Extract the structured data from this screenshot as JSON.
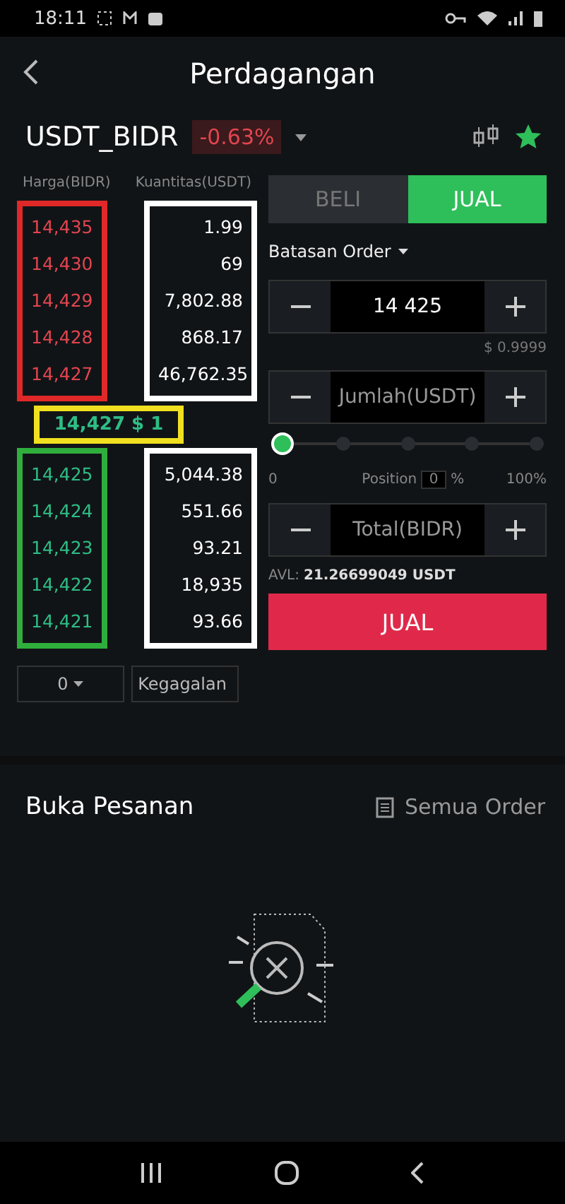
{
  "status_bar": {
    "time": "18:11"
  },
  "header": {
    "title": "Perdagangan"
  },
  "pair": {
    "symbol": "USDT_BIDR",
    "change": "-0.63%"
  },
  "order_book": {
    "price_heading": "Harga(BIDR)",
    "qty_heading": "Kuantitas(USDT)",
    "asks": [
      {
        "price": "14,435",
        "qty": "1.99"
      },
      {
        "price": "14,430",
        "qty": "69"
      },
      {
        "price": "14,429",
        "qty": "7,802.88"
      },
      {
        "price": "14,428",
        "qty": "868.17"
      },
      {
        "price": "14,427",
        "qty": "46,762.35"
      }
    ],
    "last_price": "14,427 $ 1",
    "bids": [
      {
        "price": "14,425",
        "qty": "5,044.38"
      },
      {
        "price": "14,424",
        "qty": "551.66"
      },
      {
        "price": "14,423",
        "qty": "93.21"
      },
      {
        "price": "14,422",
        "qty": "18,935"
      },
      {
        "price": "14,421",
        "qty": "93.66"
      }
    ],
    "precision": "0",
    "mode": "Kegagalan"
  },
  "trade": {
    "tabs": [
      {
        "label": "BELI",
        "selected": false
      },
      {
        "label": "JUAL",
        "selected": true
      }
    ],
    "order_type": "Batasan Order",
    "price_value": "14 425",
    "price_usd": "$ 0.9999",
    "amount_placeholder": "Jumlah(USDT)",
    "slider": {
      "level": 0,
      "min_label": "0",
      "position_label": "Position",
      "position_value": "0",
      "percent": "%",
      "max_label": "100%"
    },
    "total_placeholder": "Total(BIDR)",
    "avl_label": "AVL:",
    "avl_value": "21.26699049 USDT",
    "submit": "JUAL"
  },
  "open_orders": {
    "title": "Buka Pesanan",
    "all_link": "Semua Order"
  }
}
